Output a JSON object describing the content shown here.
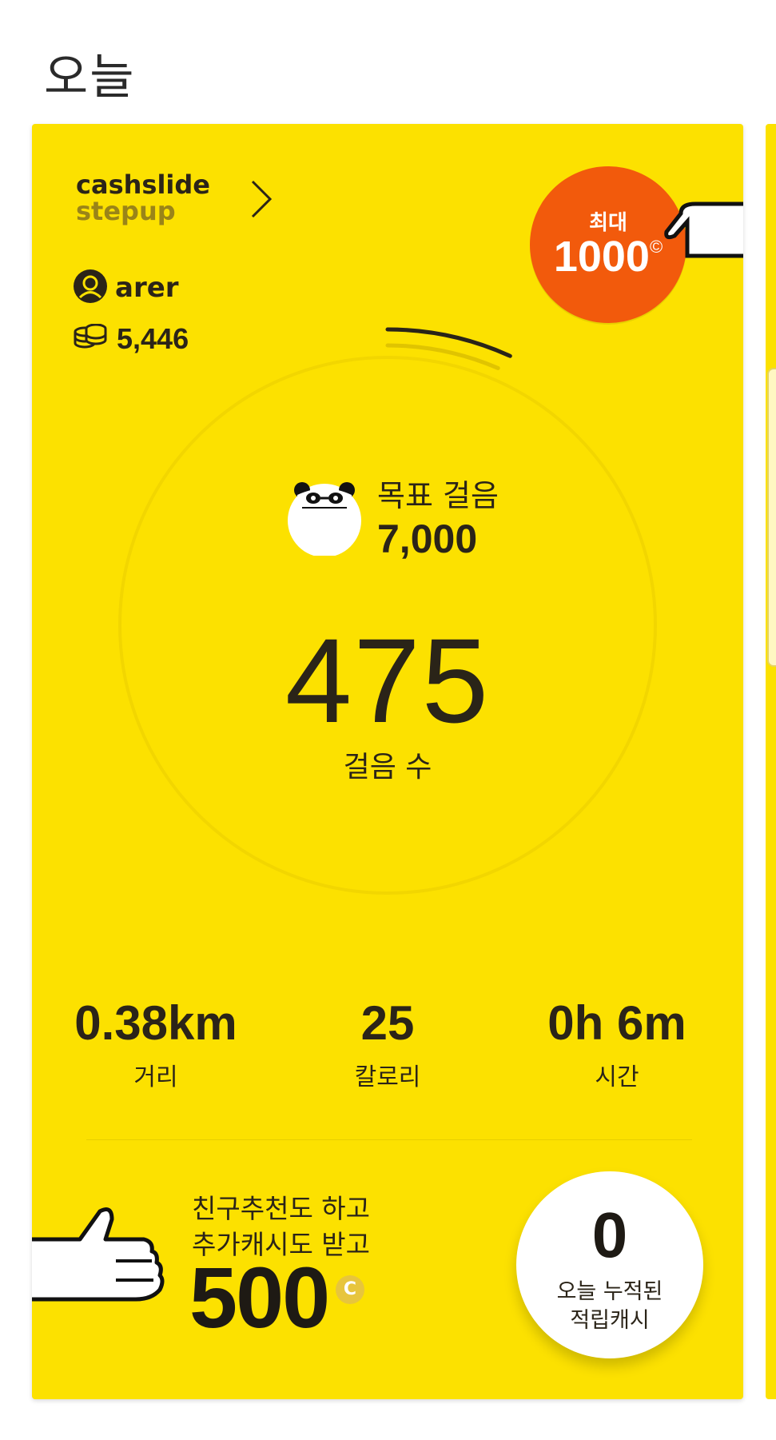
{
  "header": {
    "title": "오늘"
  },
  "brand": {
    "line1": "cashslide",
    "line2": "stepup"
  },
  "user": {
    "name": "arer",
    "coins": "5,446"
  },
  "badge": {
    "label": "최대",
    "value": "1000",
    "symbol": "©"
  },
  "goal": {
    "label": "목표 걸음",
    "value": "7,000"
  },
  "steps": {
    "count": "475",
    "label": "걸음 수",
    "progress": 0.068
  },
  "stats": [
    {
      "value": "0.38km",
      "label": "거리"
    },
    {
      "value": "25",
      "label": "칼로리"
    },
    {
      "value": "0h 6m",
      "label": "시간"
    }
  ],
  "promo": {
    "line1": "친구추천도 하고",
    "line2": "추가캐시도 받고",
    "amount": "500",
    "coin_symbol": "C"
  },
  "today": {
    "value": "0",
    "label_line1": "오늘 누적된",
    "label_line2": "적립캐시"
  },
  "colors": {
    "card_bg": "#fce100",
    "badge_bg": "#f25a0c",
    "text_dark": "#2b2418"
  }
}
